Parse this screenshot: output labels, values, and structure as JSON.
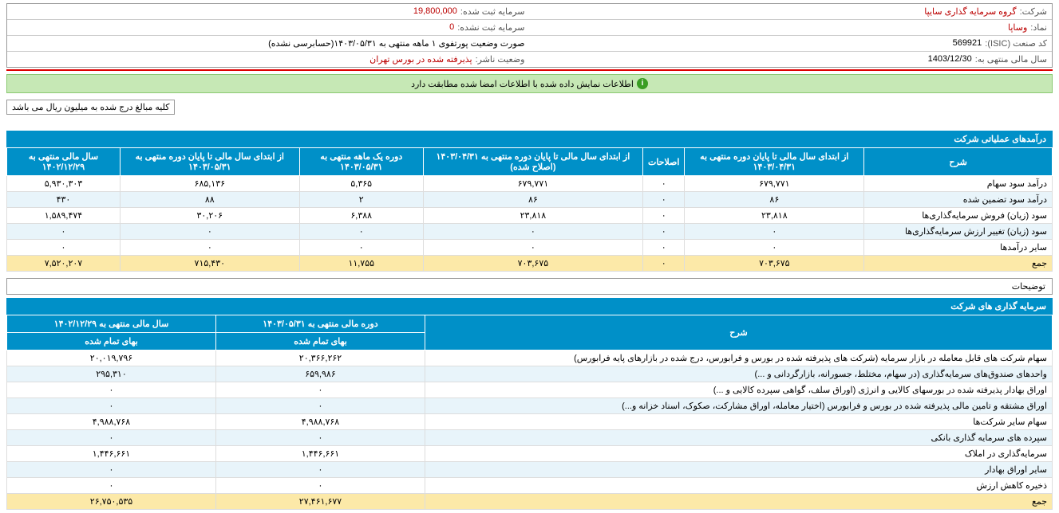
{
  "info": {
    "company_label": "شرکت:",
    "company_value": "گروه سرمایه گذاری سایپا",
    "capital_reg_label": "سرمایه ثبت شده:",
    "capital_reg_value": "19,800,000",
    "symbol_label": "نماد:",
    "symbol_value": "وساپا",
    "capital_unreg_label": "سرمایه ثبت نشده:",
    "capital_unreg_value": "0",
    "isic_label": "کد صنعت (ISIC):",
    "isic_value": "569921",
    "portfolio_status_value": "صورت وضعیت پورتفوی ۱ ماهه منتهی به ۱۴۰۳/۰۵/۳۱(حسابرسی نشده)",
    "fiscal_end_label": "سال مالی منتهی به:",
    "fiscal_end_value": "1403/12/30",
    "publisher_status_label": "وضعیت ناشر:",
    "publisher_status_value": "پذیرفته شده در بورس تهران"
  },
  "banner_text": "اطلاعات نمایش داده شده با اطلاعات امضا شده مطابقت دارد",
  "note_text": "کلیه مبالغ درج شده به میلیون ریال می باشد",
  "table1": {
    "title": "درآمدهای عملیاتی شرکت",
    "headers": [
      "شرح",
      "از ابتدای سال مالی تا پایان دوره منتهی به ۱۴۰۳/۰۴/۳۱",
      "اصلاحات",
      "از ابتدای سال مالی تا پایان دوره منتهی به ۱۴۰۳/۰۴/۳۱ (اصلاح شده)",
      "دوره یک ماهه منتهی به ۱۴۰۳/۰۵/۳۱",
      "از ابتدای سال مالی تا پایان دوره منتهی به ۱۴۰۳/۰۵/۳۱",
      "سال مالی منتهی به ۱۴۰۲/۱۲/۲۹"
    ],
    "rows": [
      {
        "c": [
          "درآمد سود سهام",
          "۶۷۹,۷۷۱",
          "۰",
          "۶۷۹,۷۷۱",
          "۵,۳۶۵",
          "۶۸۵,۱۳۶",
          "۵,۹۳۰,۳۰۳"
        ],
        "cls": "row-odd"
      },
      {
        "c": [
          "درآمد سود تضمین شده",
          "۸۶",
          "۰",
          "۸۶",
          "۲",
          "۸۸",
          "۴۳۰"
        ],
        "cls": "row-even"
      },
      {
        "c": [
          "سود (زیان) فروش سرمایه‌گذاری‌ها",
          "۲۳,۸۱۸",
          "۰",
          "۲۳,۸۱۸",
          "۶,۳۸۸",
          "۳۰,۲۰۶",
          "۱,۵۸۹,۴۷۴"
        ],
        "cls": "row-odd"
      },
      {
        "c": [
          "سود (زیان) تغییر ارزش سرمایه‌گذاری‌ها",
          "۰",
          "۰",
          "۰",
          "۰",
          "۰",
          "۰"
        ],
        "cls": "row-even"
      },
      {
        "c": [
          "سایر درآمدها",
          "۰",
          "۰",
          "۰",
          "۰",
          "۰",
          "۰"
        ],
        "cls": "row-odd"
      },
      {
        "c": [
          "جمع",
          "۷۰۳,۶۷۵",
          "۰",
          "۷۰۳,۶۷۵",
          "۱۱,۷۵۵",
          "۷۱۵,۴۳۰",
          "۷,۵۲۰,۲۰۷"
        ],
        "cls": "row-sum"
      }
    ]
  },
  "desc_label": "توضیحات",
  "table2": {
    "title": "سرمایه گذاری های شرکت",
    "header_top": [
      "شرح",
      "دوره مالی منتهی به ۱۴۰۳/۰۵/۳۱",
      "سال مالی منتهی به ۱۴۰۲/۱۲/۲۹"
    ],
    "header_sub": [
      "بهای تمام شده",
      "بهای تمام شده"
    ],
    "rows": [
      {
        "c": [
          "سهام شرکت های قابل معامله در بازار سرمایه (شرکت های پذیرفته شده در بورس و فرابورس، درج شده در بازارهای پایه فرابورس)",
          "۲۰,۳۶۶,۲۶۲",
          "۲۰,۰۱۹,۷۹۶"
        ],
        "cls": "row-odd"
      },
      {
        "c": [
          "واحدهای صندوق‌های سرمایه‌گذاری (در سهام، مختلط، جسورانه، بازارگردانی و ...)",
          "۶۵۹,۹۸۶",
          "۲۹۵,۳۱۰"
        ],
        "cls": "row-even"
      },
      {
        "c": [
          "اوراق بهادار پذیرفته شده در بورسهای کالایی و انرژی (اوراق سلف، گواهی سپرده کالایی و ...)",
          "۰",
          "۰"
        ],
        "cls": "row-odd"
      },
      {
        "c": [
          "اوراق مشتقه و تامین مالی پذیرفته شده در بورس و فرابورس (اختیار معامله، اوراق مشارکت، صکوک، اسناد خزانه و...)",
          "۰",
          "۰"
        ],
        "cls": "row-even"
      },
      {
        "c": [
          "سهام سایر شرکت‌ها",
          "۴,۹۸۸,۷۶۸",
          "۴,۹۸۸,۷۶۸"
        ],
        "cls": "row-odd"
      },
      {
        "c": [
          "سپرده های سرمایه گذاری بانکی",
          "۰",
          "۰"
        ],
        "cls": "row-even"
      },
      {
        "c": [
          "سرمایه‌گذاری در املاک",
          "۱,۴۴۶,۶۶۱",
          "۱,۴۴۶,۶۶۱"
        ],
        "cls": "row-odd"
      },
      {
        "c": [
          "سایر اوراق بهادار",
          "۰",
          "۰"
        ],
        "cls": "row-even"
      },
      {
        "c": [
          "ذخیره کاهش ارزش",
          "۰",
          "۰"
        ],
        "cls": "row-odd"
      },
      {
        "c": [
          "جمع",
          "۲۷,۴۶۱,۶۷۷",
          "۲۶,۷۵۰,۵۳۵"
        ],
        "cls": "row-sum"
      }
    ]
  }
}
